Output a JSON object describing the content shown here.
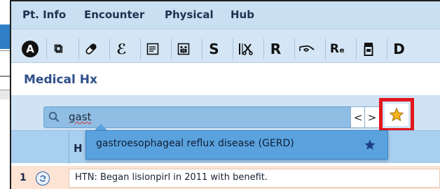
{
  "menu": [
    "Pt. Info",
    "Encounter",
    "Physical",
    "Hub"
  ],
  "toolbar": {
    "tools": [
      {
        "icon": "a-circle-icon",
        "glyph": "A"
      },
      {
        "icon": "copy-pages-icon",
        "glyph": "⧉"
      },
      {
        "icon": "pill-icon",
        "glyph": "⬬"
      },
      {
        "icon": "caduceus-icon",
        "glyph": "ℰ"
      },
      {
        "icon": "document-list-icon",
        "glyph": "▤"
      },
      {
        "icon": "family-icon",
        "glyph": "⛫"
      },
      {
        "icon": "s-icon",
        "glyph": "S"
      },
      {
        "icon": "surgery-icon",
        "glyph": "⚕"
      },
      {
        "icon": "r-icon",
        "glyph": "R"
      },
      {
        "icon": "eye-exam-icon",
        "glyph": "ᘓ"
      },
      {
        "icon": "re-icon",
        "glyph": "Rₑ"
      },
      {
        "icon": "medicine-bottle-icon",
        "glyph": "▣"
      },
      {
        "icon": "d-icon",
        "glyph": "D"
      }
    ]
  },
  "section": {
    "title": "Medical Hx"
  },
  "search": {
    "value": "gast",
    "prev_label": "<",
    "next_label": ">"
  },
  "suggestion": {
    "text": "gastroesophageal reflux disease (GERD)"
  },
  "table": {
    "header_label": "H",
    "rows": [
      {
        "number": "1",
        "text": "HTN: Began lisionpirl in 2011 with benefit."
      }
    ]
  },
  "colors": {
    "accent": "#5aa2de",
    "highlight_border": "#e3161b",
    "star": "#f4b21d",
    "row_bg": "#fde3d3"
  }
}
